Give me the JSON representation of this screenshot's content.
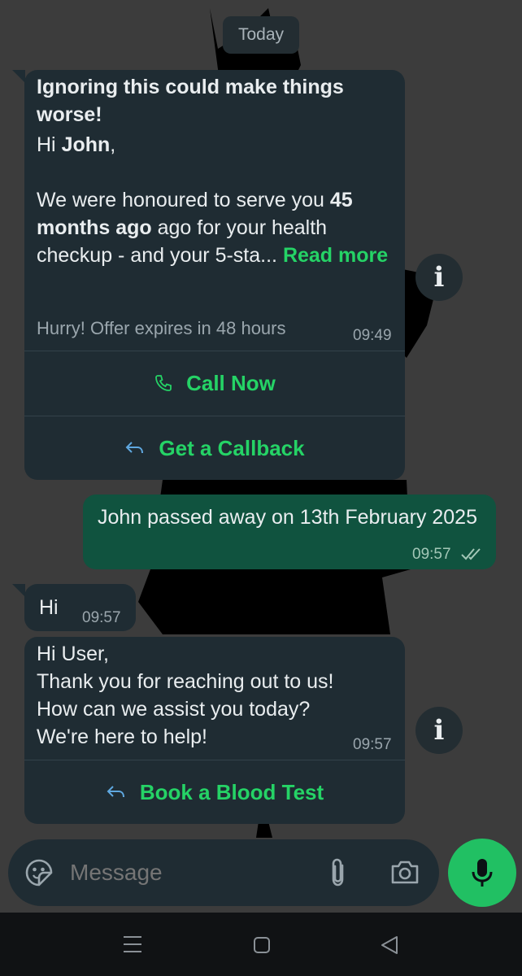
{
  "date_chip": "Today",
  "msg1": {
    "title": "Ignoring this could make things worse!",
    "greeting_prefix": "Hi ",
    "greeting_name": "John",
    "greeting_suffix": ",",
    "body_1": "We were honoured to serve you ",
    "body_bold": "45 months ago",
    "body_2": " ago for your health checkup - and your 5-sta... ",
    "read_more": "Read more",
    "footer": "Hurry! Offer expires in 48 hours",
    "time": "09:49",
    "call_now": "Call Now",
    "get_callback": "Get a Callback"
  },
  "msg2": {
    "text": "John passed away on 13th February 2025",
    "time": "09:57"
  },
  "msg3": {
    "text": "Hi",
    "time": "09:57"
  },
  "msg4": {
    "line1": "Hi User,",
    "line2": "Thank you  for reaching out to us!",
    "line3": "How can we assist you today?",
    "line4": "We're here to help!",
    "time": "09:57",
    "book_button": "Book a Blood Test"
  },
  "info_icon": "i",
  "input": {
    "placeholder": "Message"
  },
  "colors": {
    "accent": "#25d366",
    "bubble_in": "#1f2c33",
    "bubble_out": "#10533f",
    "mic": "#21c063"
  }
}
